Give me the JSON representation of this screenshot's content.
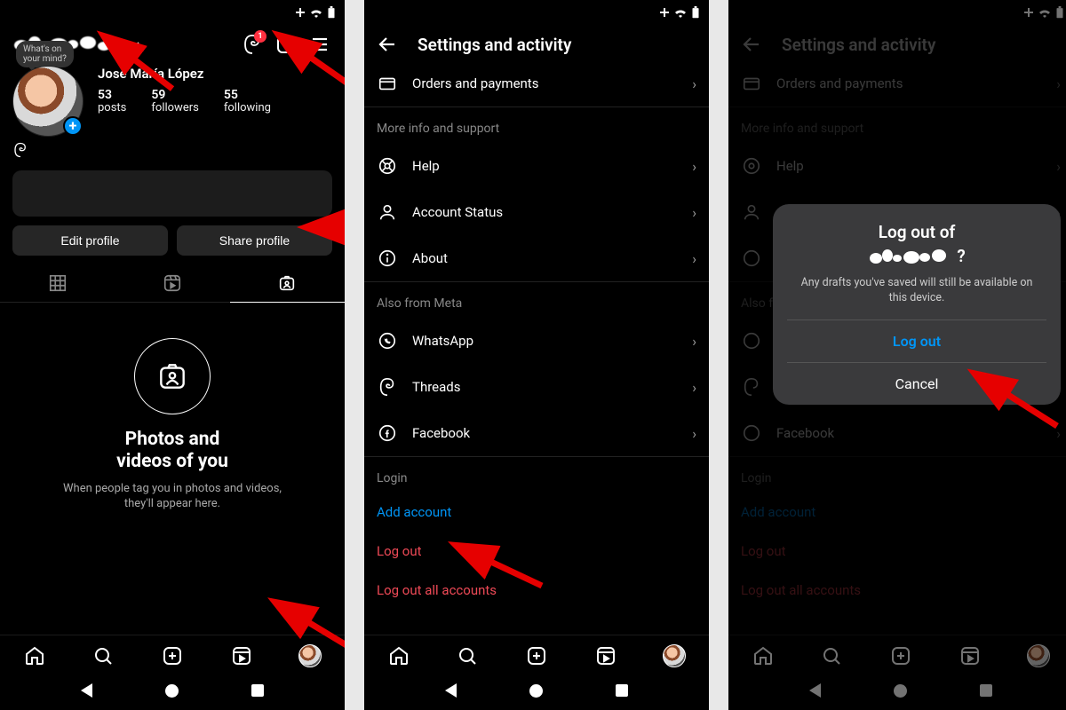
{
  "statusBadge": "1",
  "storyBubble": "What's on\nyour mind?",
  "displayName": "José María López",
  "stats": {
    "posts": {
      "num": "53",
      "label": "posts"
    },
    "followers": {
      "num": "59",
      "label": "followers"
    },
    "following": {
      "num": "55",
      "label": "following"
    }
  },
  "actions": {
    "edit": "Edit profile",
    "share": "Share profile"
  },
  "empty": {
    "title": "Photos and\nvideos of you",
    "sub": "When people tag you in photos and videos, they'll appear here."
  },
  "settings": {
    "title": "Settings and activity",
    "orders": "Orders and payments",
    "sectionSupport": "More info and support",
    "help": "Help",
    "accountStatus": "Account Status",
    "about": "About",
    "sectionMeta": "Also from Meta",
    "whatsapp": "WhatsApp",
    "threads": "Threads",
    "facebook": "Facebook",
    "sectionLogin": "Login",
    "addAccount": "Add account",
    "logout": "Log out",
    "logoutAll": "Log out all accounts"
  },
  "dialog": {
    "titlePrefix": "Log out of",
    "sub": "Any drafts you've saved will still be available on this device.",
    "primary": "Log out",
    "cancel": "Cancel"
  }
}
